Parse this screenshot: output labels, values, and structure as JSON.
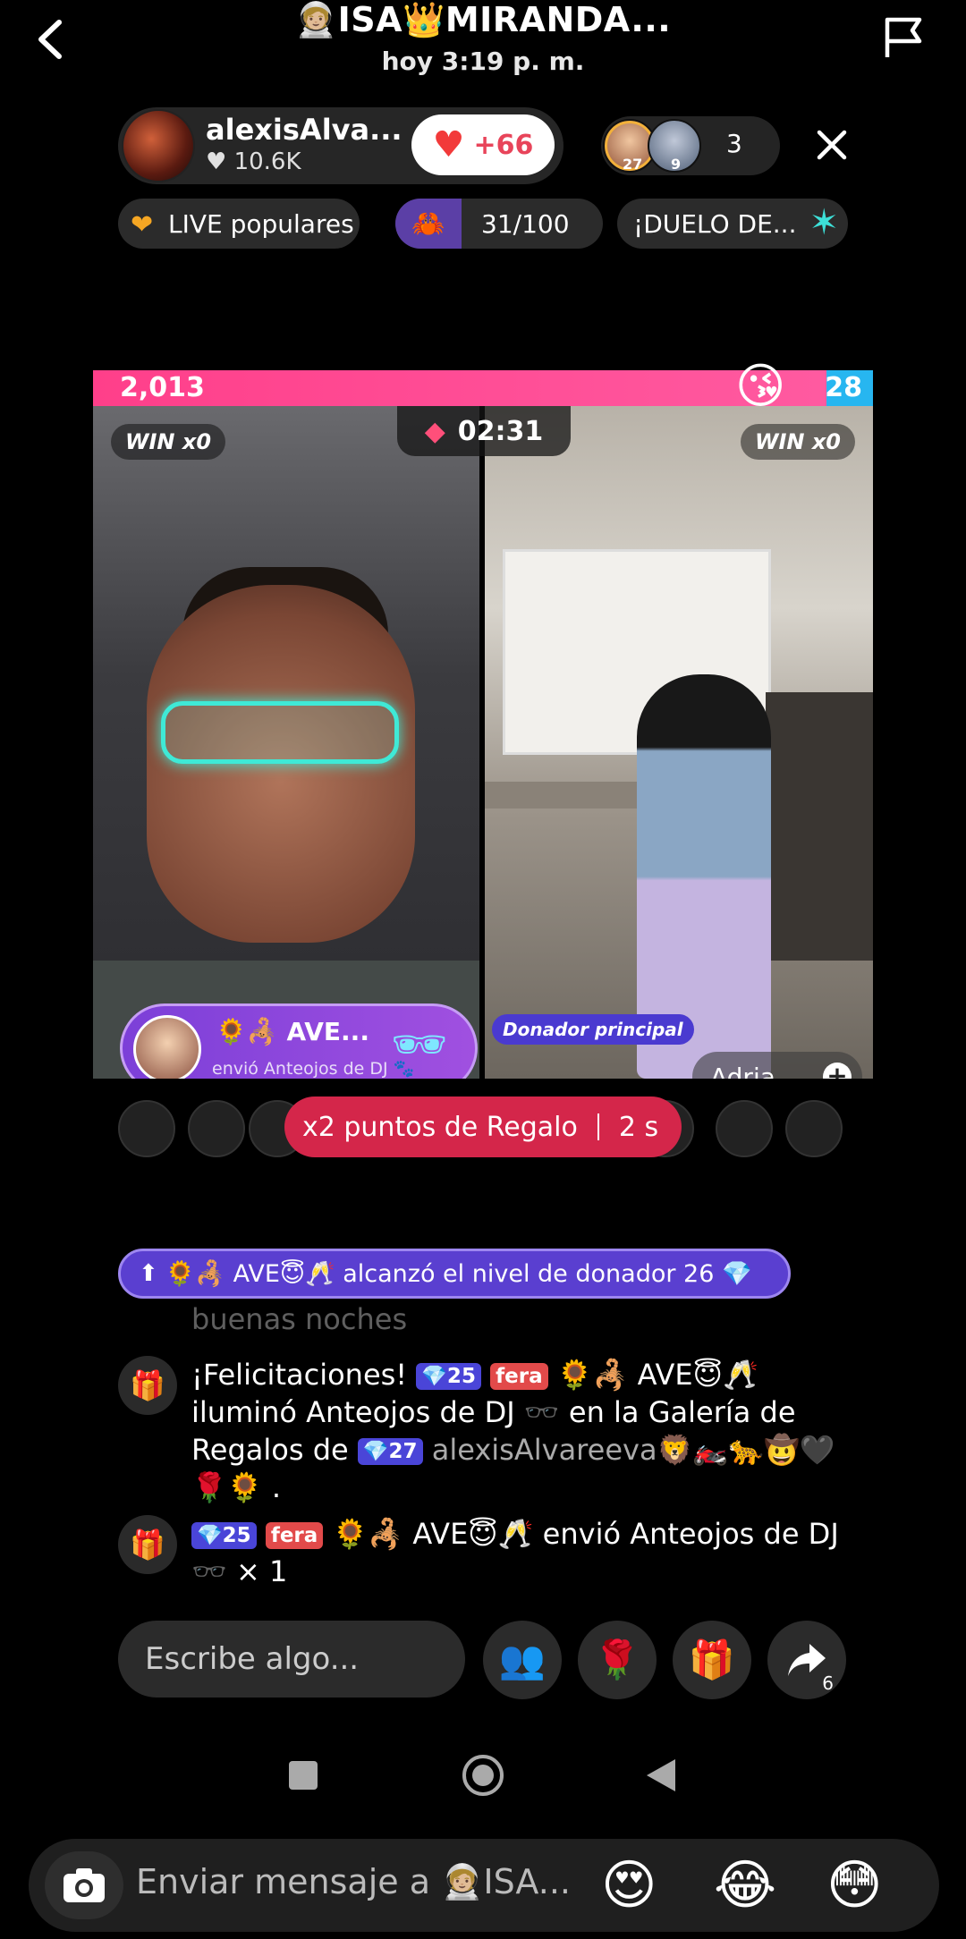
{
  "story": {
    "title": "🧑🏼‍🚀ISA👑MIRANDA...",
    "time": "hoy 3:19 p. m."
  },
  "live": {
    "host_name": "alexisAlva...",
    "host_likes": "♥ 10.6K",
    "follow_count": "+66",
    "viewer1_level": "27",
    "viewer2_level": "9",
    "viewer_count": "3",
    "tags": {
      "popular": "LIVE populares",
      "goal": "31/100",
      "duel": "¡DUELO DE..."
    }
  },
  "battle": {
    "score_left": "2,013",
    "score_right": "28",
    "win_left": "WIN x0",
    "win_right": "WIN x0",
    "timer": "02:31",
    "gift_toast": {
      "name": "🌻🦂 AVE...",
      "subtitle": "envió Anteojos de DJ 🐾"
    },
    "top_donor": "Donador principal",
    "opponent_name": "Adria..."
  },
  "promo": {
    "label": "x2 puntos de Regalo",
    "countdown": "2 s"
  },
  "level_banner": "🌻🦂 AVE😇🥂 alcanzó el nivel de donador 26 💎",
  "faded_msg": "buenas noches",
  "messages": [
    {
      "prefix": "¡Felicitaciones! ",
      "level": "💎25",
      "fan": "fera",
      "text1": " 🌻🦂 AVE😇🥂 iluminó Anteojos de DJ 🕶️ en la Galería de Regalos de ",
      "level2": "💎27",
      "muted": " alexisAlvareeva🦁🏍️🐆🤠🖤",
      "text2": " 🌹🌻 ."
    },
    {
      "level": "💎25",
      "fan": "fera",
      "text1": " 🌻🦂 AVE😇🥂 envió Anteojos de DJ 🕶️ × 1"
    }
  ],
  "composer": {
    "placeholder": "Escribe algo...",
    "share_count": "6"
  },
  "reply": {
    "placeholder": "Enviar mensaje a 🧑🏼‍🚀ISA...",
    "emoji1": "😍",
    "emoji2": "😂",
    "emoji3": "😳"
  },
  "colors": {
    "score_left": "#ff3f8a",
    "score_right": "#27b6f0",
    "promo": "#d4264a",
    "level_banner": "#5a3fd0"
  }
}
